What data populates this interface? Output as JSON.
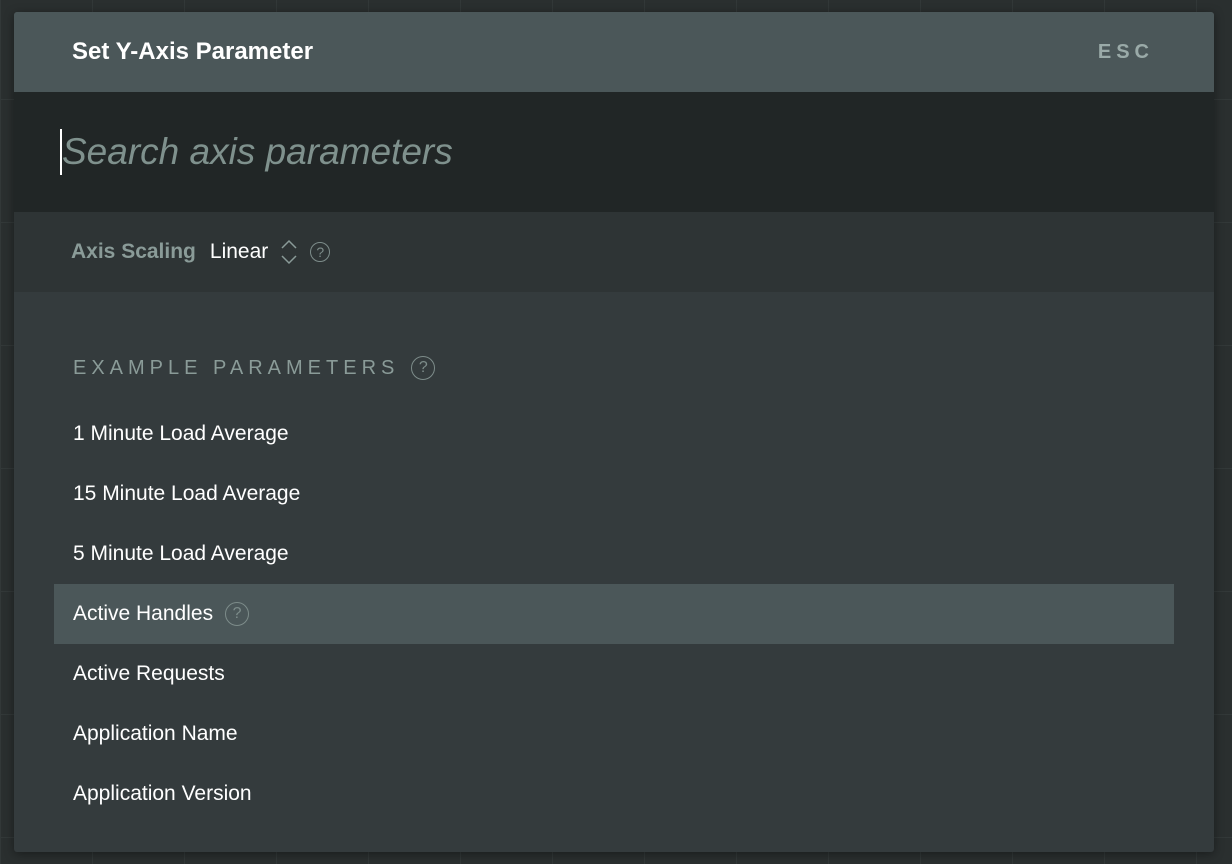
{
  "dialog": {
    "title": "Set Y-Axis Parameter",
    "close_label": "ESC"
  },
  "search": {
    "placeholder": "Search axis parameters",
    "value": ""
  },
  "scaling": {
    "label": "Axis Scaling",
    "value": "Linear",
    "stepper_icon": "chevron-up-down-icon",
    "help_icon": "question-circle-icon"
  },
  "list": {
    "section_title": "EXAMPLE PARAMETERS",
    "items": [
      {
        "label": "1 Minute Load Average"
      },
      {
        "label": "15 Minute Load Average"
      },
      {
        "label": "5 Minute Load Average"
      },
      {
        "label": "Active Handles",
        "highlighted": true
      },
      {
        "label": "Active Requests"
      },
      {
        "label": "Application Name"
      },
      {
        "label": "Application Version"
      }
    ]
  },
  "colors": {
    "header": "#4b5759",
    "search_bg": "#212626",
    "list_bg": "#343b3d",
    "highlight": "#4b5759"
  }
}
